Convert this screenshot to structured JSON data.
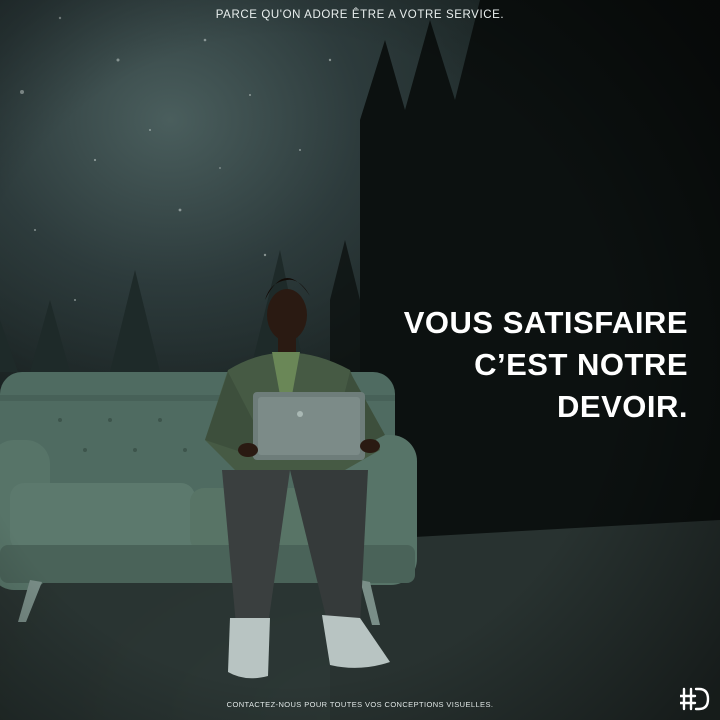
{
  "poster": {
    "tagline": "PARCE QU'ON ADORE ÊTRE A VOTRE SERVICE.",
    "headline": [
      "VOUS SATISFAIRE",
      "C’EST NOTRE",
      "DEVOIR."
    ],
    "footer": "CONTACTEZ-NOUS POUR TOUTES VOS CONCEPTIONS VISUELLES."
  },
  "colors": {
    "text": "#ffffff",
    "sofa": "#4f6b61",
    "sky": "#3e5150"
  },
  "icons": {
    "logo": "hd-monogram-logo"
  }
}
